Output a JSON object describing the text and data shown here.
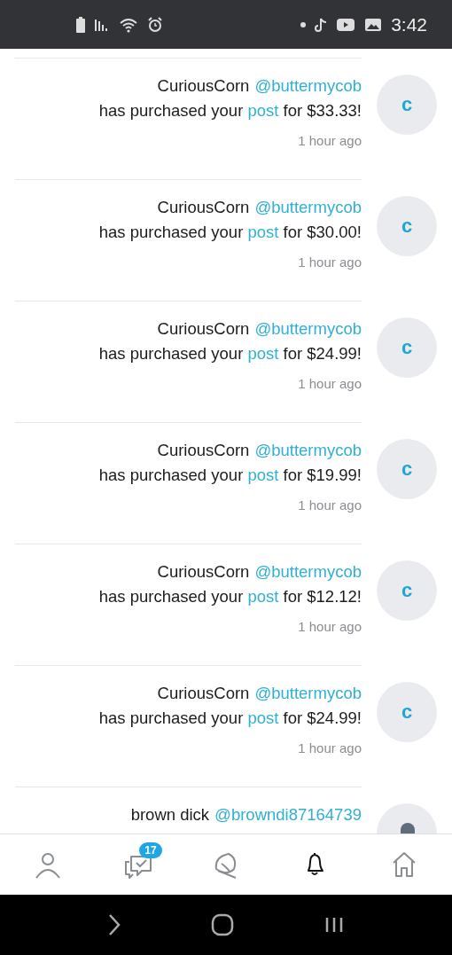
{
  "status_bar": {
    "time": "3:42"
  },
  "notifications": [
    {
      "kind": "purchase",
      "avatar_initial": "c",
      "name": "CuriousCorn",
      "handle": "@buttermycob",
      "text_before": "has purchased your ",
      "link": "post",
      "text_after": " for $33.33!",
      "time": "1 hour ago"
    },
    {
      "kind": "purchase",
      "avatar_initial": "c",
      "name": "CuriousCorn",
      "handle": "@buttermycob",
      "text_before": "has purchased your ",
      "link": "post",
      "text_after": " for $30.00!",
      "time": "1 hour ago"
    },
    {
      "kind": "purchase",
      "avatar_initial": "c",
      "name": "CuriousCorn",
      "handle": "@buttermycob",
      "text_before": "has purchased your ",
      "link": "post",
      "text_after": " for $24.99!",
      "time": "1 hour ago"
    },
    {
      "kind": "purchase",
      "avatar_initial": "c",
      "name": "CuriousCorn",
      "handle": "@buttermycob",
      "text_before": "has purchased your ",
      "link": "post",
      "text_after": " for $19.99!",
      "time": "1 hour ago"
    },
    {
      "kind": "purchase",
      "avatar_initial": "c",
      "name": "CuriousCorn",
      "handle": "@buttermycob",
      "text_before": "has purchased your ",
      "link": "post",
      "text_after": " for $12.12!",
      "time": "1 hour ago"
    },
    {
      "kind": "purchase",
      "avatar_initial": "c",
      "name": "CuriousCorn",
      "handle": "@buttermycob",
      "text_before": "has purchased your ",
      "link": "post",
      "text_after": " for $24.99!",
      "time": "1 hour ago"
    },
    {
      "kind": "partial",
      "name": "brown dick",
      "handle": "@browndi87164739"
    }
  ],
  "bottom_nav": [
    {
      "kind": "profile",
      "selected": false
    },
    {
      "kind": "messages",
      "selected": false,
      "badge": "17"
    },
    {
      "kind": "explore",
      "selected": false
    },
    {
      "kind": "notifications",
      "selected": true
    },
    {
      "kind": "home",
      "selected": false
    }
  ]
}
